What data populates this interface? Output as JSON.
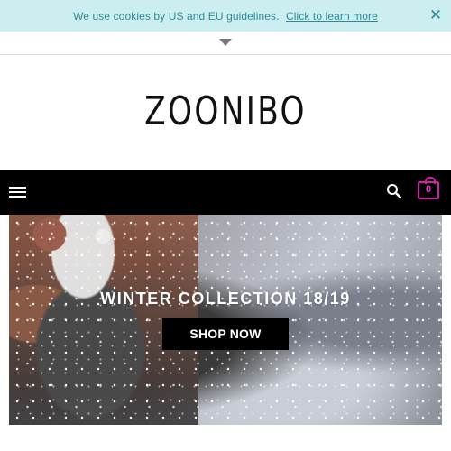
{
  "cookie_bar": {
    "message": "We use cookies by US and EU guidelines.",
    "link_text": "Click to learn more",
    "close_symbol": "✕",
    "text_color": "#2c8a95",
    "background": "#cdeef1"
  },
  "toggle": {
    "icon": "triangle-down-icon"
  },
  "brand": {
    "logo_text": "ZOONIBO"
  },
  "navbar": {
    "menu_icon": "hamburger-icon",
    "search_icon": "search-icon",
    "cart_icon": "shopping-bag-icon",
    "cart_count": "0",
    "cart_color": "#d61fa8",
    "background": "#000000"
  },
  "hero": {
    "title": "WINTER COLLECTION 18/19",
    "cta_label": "SHOP NOW",
    "background_icon": "winter-photo"
  }
}
